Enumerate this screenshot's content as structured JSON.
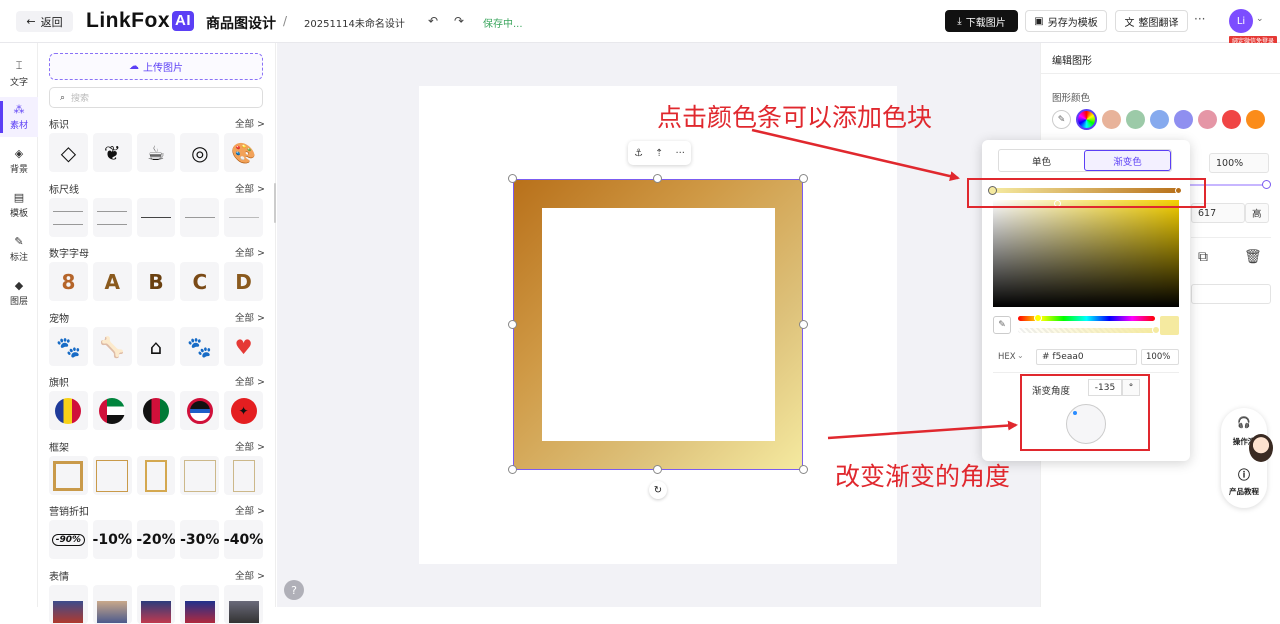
{
  "topbar": {
    "back_label": "返回",
    "logo_text": "LinkFox",
    "logo_ai": "AI",
    "product_name": "商品图设计",
    "separator": "/",
    "filename": "20251114未命名设计",
    "status": "保存中...",
    "download_label": "下载图片",
    "save_template_label": "另存为模板",
    "translate_label": "整图翻译",
    "more_label": "···",
    "avatar_text": "Li",
    "wechat_badge": "绑定微信免登录"
  },
  "rail": [
    {
      "label": "文字",
      "icon": "text-icon"
    },
    {
      "label": "素材",
      "icon": "assets-icon",
      "active": true
    },
    {
      "label": "背景",
      "icon": "background-icon"
    },
    {
      "label": "模板",
      "icon": "template-icon"
    },
    {
      "label": "标注",
      "icon": "annotation-icon"
    },
    {
      "label": "图层",
      "icon": "layers-icon"
    }
  ],
  "panel": {
    "upload_label": "上传图片",
    "search_placeholder": "搜索",
    "all_label": "全部 >",
    "sections": [
      {
        "title": "标识",
        "thumbs": [
          "◇",
          "❦",
          "☕",
          "◎",
          "🎨"
        ]
      },
      {
        "title": "标尺线",
        "thumbs": [
          "",
          "",
          "",
          "",
          ""
        ]
      },
      {
        "title": "数字字母",
        "thumbs": [
          "8",
          "A",
          "B",
          "C",
          "D"
        ]
      },
      {
        "title": "宠物",
        "thumbs": [
          "🐾",
          "🦴",
          "⌂",
          "🐾",
          "♥"
        ]
      },
      {
        "title": "旗帜",
        "thumbs": [
          "",
          "",
          "",
          "",
          ""
        ]
      },
      {
        "title": "框架",
        "thumbs": [
          "",
          "",
          "",
          "",
          ""
        ]
      },
      {
        "title": "营销折扣",
        "thumbs": [
          "-90%",
          "-10%",
          "-20%",
          "-30%",
          "-40%"
        ]
      },
      {
        "title": "表情",
        "thumbs": [
          "",
          "",
          "",
          "",
          ""
        ]
      }
    ]
  },
  "canvas": {
    "toolbar_items": [
      "⚓",
      "⇡",
      "···"
    ],
    "rotate_icon": "↻",
    "help_label": "?"
  },
  "right_panel": {
    "title": "编辑图形",
    "color_label": "图形颜色",
    "swatches": [
      "#e8b39a",
      "#9ccaa8",
      "#86aaee",
      "#8f8ff0",
      "#e596a6",
      "#f04545",
      "#fb8c1a"
    ],
    "opacity_value": "100%",
    "height_value": "617",
    "height_label": "高"
  },
  "popover": {
    "tab_solid": "单色",
    "tab_gradient": "渐变色",
    "hex_label": "HEX",
    "hex_value": "# f5eaa0",
    "hex_alpha": "100%",
    "angle_label": "渐变角度",
    "angle_value": "-135",
    "angle_unit": "°",
    "gradient_start": "#f5eaa0",
    "gradient_end": "#b8701a"
  },
  "annotations": {
    "top_text": "点击颜色条可以添加色块",
    "bottom_text": "改变渐变的角度",
    "color": "#e0282e"
  },
  "helper": {
    "item1": "操作演",
    "item2": "产品教程"
  }
}
